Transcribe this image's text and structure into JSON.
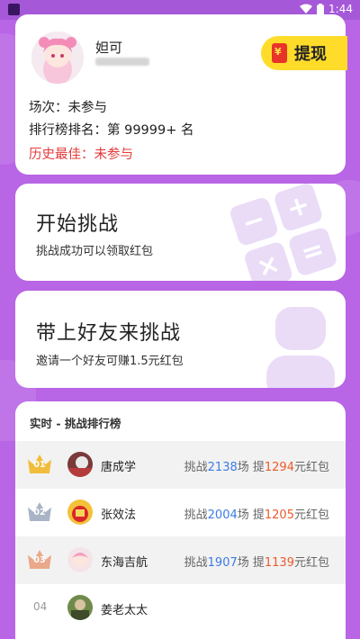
{
  "status_bar": {
    "time": "1:44"
  },
  "profile": {
    "username": "妲可",
    "withdraw_label": "提现",
    "stats": {
      "sessions": "场次：未参与",
      "rank": "排行榜排名：第 99999+ 名",
      "best": "历史最佳：未参与"
    }
  },
  "actions": {
    "start": {
      "title": "开始挑战",
      "subtitle": "挑战成功可以领取红包"
    },
    "invite": {
      "title": "带上好友来挑战",
      "subtitle": "邀请一个好友可赚1.5元红包"
    }
  },
  "leaderboard": {
    "title": "实时 - 挑战排行榜",
    "prefix_challenge": "挑战",
    "unit_sessions": "场 提",
    "unit_redpacket": "元红包",
    "rows": [
      {
        "rank": "01",
        "name": "唐成学",
        "count": "2138",
        "amount": "1294"
      },
      {
        "rank": "02",
        "name": "张效法",
        "count": "2004",
        "amount": "1205"
      },
      {
        "rank": "03",
        "name": "东海吉航",
        "count": "1907",
        "amount": "1139"
      },
      {
        "rank": "04",
        "name": "姜老太太",
        "count": "",
        "amount": ""
      }
    ]
  },
  "colors": {
    "background": "#b865e6",
    "accent_yellow": "#ffdc2a",
    "best_red": "#e43a3a",
    "count_blue": "#3b7be6",
    "amount_orange": "#ee5a2a",
    "gold_crown": "#f0bd3c",
    "silver_crown": "#a9b4c6",
    "bronze_crown": "#e9a98a"
  }
}
